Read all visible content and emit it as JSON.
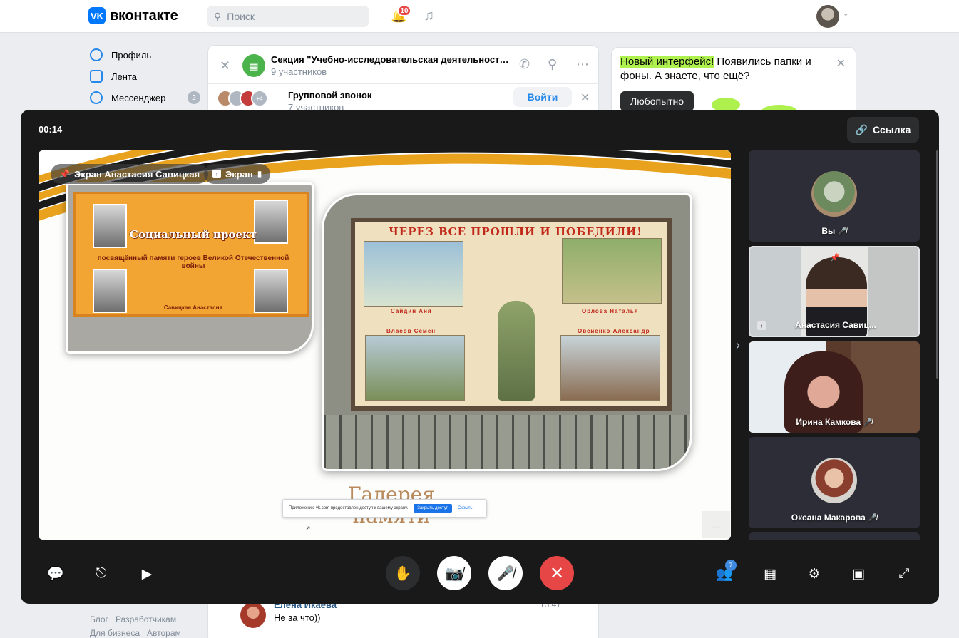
{
  "vk": {
    "logo_mark": "VK",
    "logo_text": "вконтакте",
    "search_placeholder": "Поиск",
    "notifications_count": "10",
    "nav": [
      {
        "label": "Профиль"
      },
      {
        "label": "Лента"
      },
      {
        "label": "Мессенджер",
        "badge": "2"
      }
    ],
    "footer": [
      "Блог",
      "Разработчикам",
      "Для бизнеса",
      "Авторам"
    ]
  },
  "chat": {
    "title": "Секция \"Учебно-исследовательская деятельность: о...",
    "members": "9 участников",
    "group_call": {
      "title": "Групповой звонок",
      "members": "7 участников",
      "extra_count": "+4",
      "join_label": "Войти"
    },
    "last_message": {
      "author": "Елена Икаева",
      "text": "Не за что))",
      "time": "13:47"
    }
  },
  "promo": {
    "highlight": "Новый интерфейс!",
    "text": " Появились папки и фоны. А знаете, что ещё?",
    "button": "Любопытно"
  },
  "call": {
    "timer": "00:14",
    "link_label": "Ссылка",
    "screen_pill": "Экран Анастасия Савицкая",
    "screen_toggle": "Экран",
    "people_count": "7",
    "participants": [
      {
        "name": "Вы",
        "muted": true
      },
      {
        "name": "Анастасия Савиц...",
        "muted": false,
        "pinned": true
      },
      {
        "name": "Ирина Камкова",
        "muted": true
      },
      {
        "name": "Оксана Макарова",
        "muted": true
      }
    ],
    "screen": {
      "poster_left_title": "Социальный проект",
      "poster_left_sub": "посвящённый памяти героев Великой Отечественной войны",
      "poster_left_name": "Савицкая Анастасия",
      "poster_right_title": "ЧЕРЕЗ ВСЕ ПРОШЛИ И ПОБЕДИЛИ!",
      "captions": [
        "Сайдин Аня",
        "Орлова Наталья",
        "Власов Семен",
        "Овсиенко Александр"
      ],
      "gallery_line1": "Галерея",
      "gallery_line2": "памяти",
      "share_notice": "Приложению vk.com предоставлен доступ к вашему экрану.",
      "share_stop": "Закрыть доступ",
      "share_hide": "Скрыть"
    }
  },
  "colors": {
    "accent": "#2688eb",
    "call_bg": "#19191a",
    "end_call": "#e64646",
    "promo_highlight": "#aef14f"
  }
}
